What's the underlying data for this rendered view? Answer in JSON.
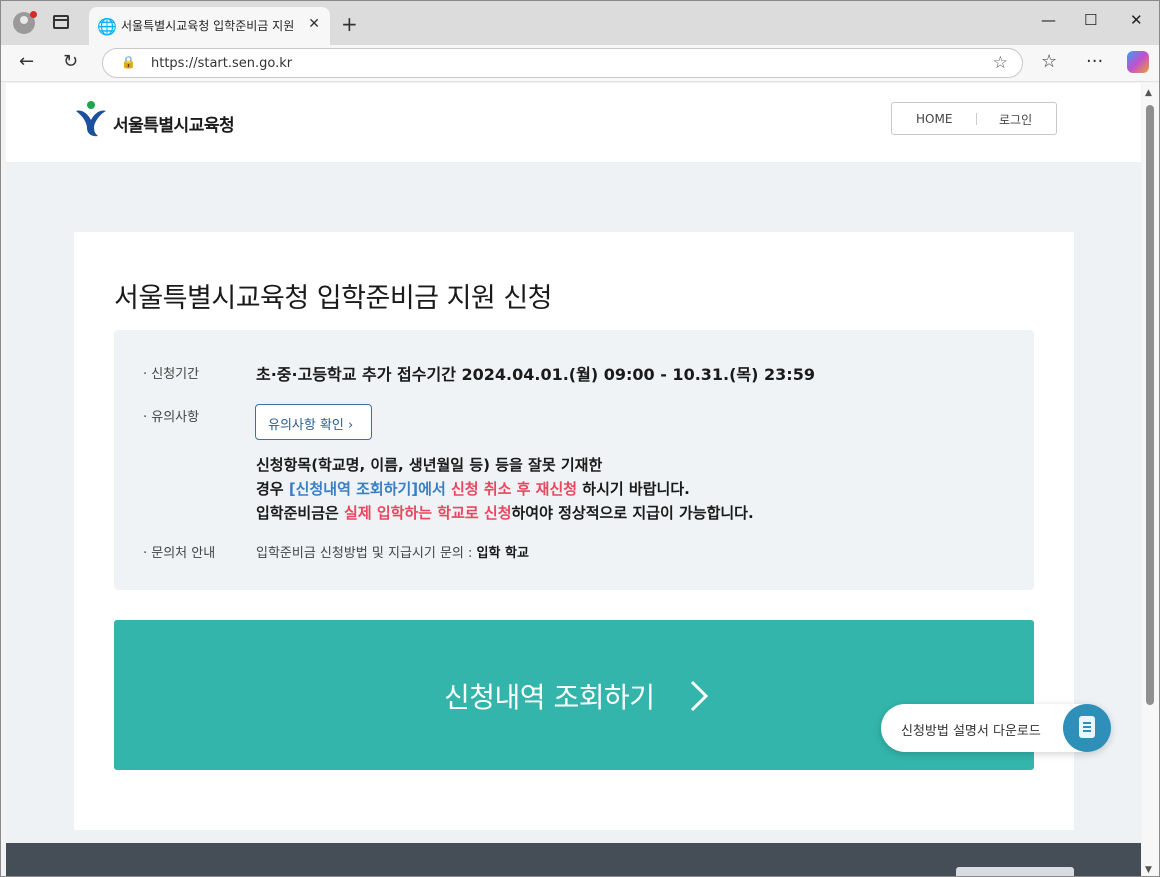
{
  "browser": {
    "tab_title": "서울특별시교육청 입학준비금 지원",
    "tab_close": "✕",
    "new_tab": "+",
    "url": "https://start.sen.go.kr",
    "icons": [
      "profile-icon",
      "tab-actions-icon",
      "globe-icon",
      "back-icon",
      "refresh-icon",
      "lock-icon",
      "favorite-star-icon",
      "favorites-icon",
      "more-icon",
      "copilot-icon",
      "minimize-icon",
      "maximize-icon",
      "close-icon"
    ],
    "controls": {
      "minimize": "—",
      "maximize": "☐",
      "close": "✕",
      "back": "←",
      "refresh": "↻",
      "favorites": "☆",
      "more": "···"
    }
  },
  "header": {
    "logo_text": "서울특별시교육청",
    "home_label": "HOME",
    "login_label": "로그인"
  },
  "main": {
    "title": "서울특별시교육청 입학준비금 지원 신청",
    "period_label": "· 신청기간",
    "period_value": "초·중·고등학교 추가 접수기간 2024.04.01.(월) 09:00 - 10.31.(목) 23:59",
    "notice_label": "· 유의사항",
    "notice_button": "유의사항 확인",
    "notice_line1": "신청항목(학교명, 이름, 생년월일 등) 등을 잘못 기재한",
    "notice_line2_a": "경우 ",
    "notice_line2_b": "[신청내역 조회하기]에서",
    "notice_line2_c": " ",
    "notice_line2_d": "신청 취소 후 재신청",
    "notice_line2_e": " 하시기 바랍니다.",
    "notice_line3_a": "입학준비금은 ",
    "notice_line3_b": "실제 입학하는 학교로 신청",
    "notice_line3_c": "하여야 정상적으로 지급이 가능합니다.",
    "contact_label": "· 문의처 안내",
    "contact_text": "입학준비금 신청방법 및 지급시기 문의 : ",
    "contact_bold": "입학 학교",
    "cta_label": "신청내역 조회하기"
  },
  "floating": {
    "label": "신청방법 설명서 다운로드"
  },
  "colors": {
    "accent_teal": "#33b5ab",
    "link_blue": "#3a7fc4",
    "warn_red": "#e8475f",
    "footer": "#454d57",
    "background": "#eef2f4"
  }
}
